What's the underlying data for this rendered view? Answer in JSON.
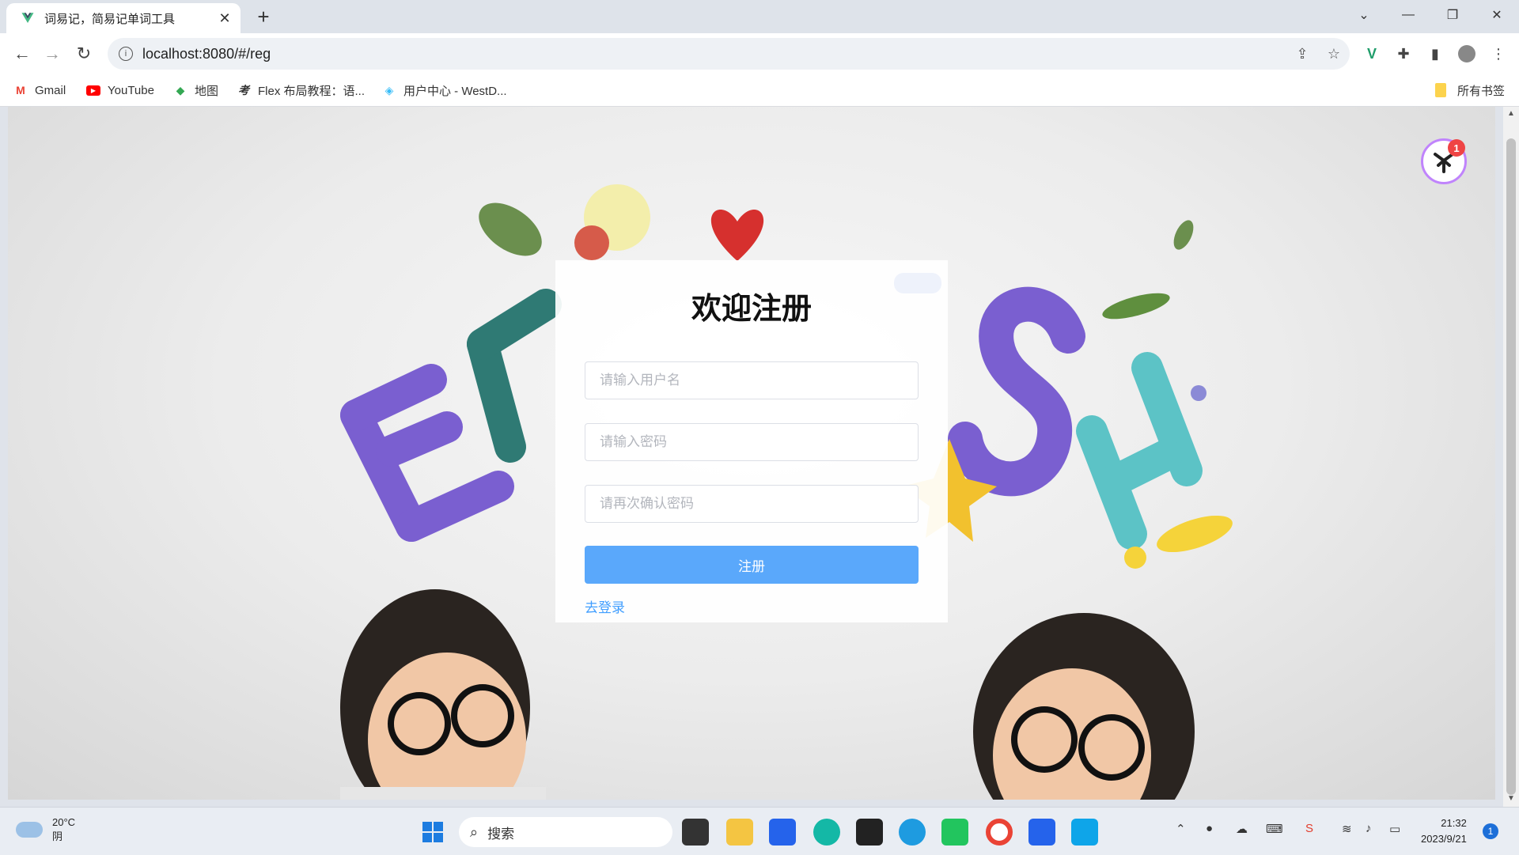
{
  "browser": {
    "tab_title": "词易记，简易记单词工具",
    "url": "localhost:8080/#/reg"
  },
  "bookmarks": [
    {
      "label": "Gmail",
      "icon": "gmail-icon"
    },
    {
      "label": "YouTube",
      "icon": "youtube-icon"
    },
    {
      "label": "地图",
      "icon": "maps-icon"
    },
    {
      "label": "Flex 布局教程：语...",
      "icon": "flex-icon"
    },
    {
      "label": "用户中心 - WestD...",
      "icon": "westd-icon"
    }
  ],
  "bookmarks_all": "所有书签",
  "form": {
    "title": "欢迎注册",
    "username_placeholder": "请输入用户名",
    "password_placeholder": "请输入密码",
    "confirm_placeholder": "请再次确认密码",
    "submit_label": "注册",
    "login_link": "去登录"
  },
  "floating_badge": "1",
  "taskbar": {
    "temperature": "20°C",
    "weather": "阴",
    "search_label": "搜索",
    "time": "21:32",
    "date": "2023/9/21",
    "notification_count": "1"
  },
  "colors": {
    "primary_button": "#5aa8fb",
    "link": "#409eff"
  }
}
